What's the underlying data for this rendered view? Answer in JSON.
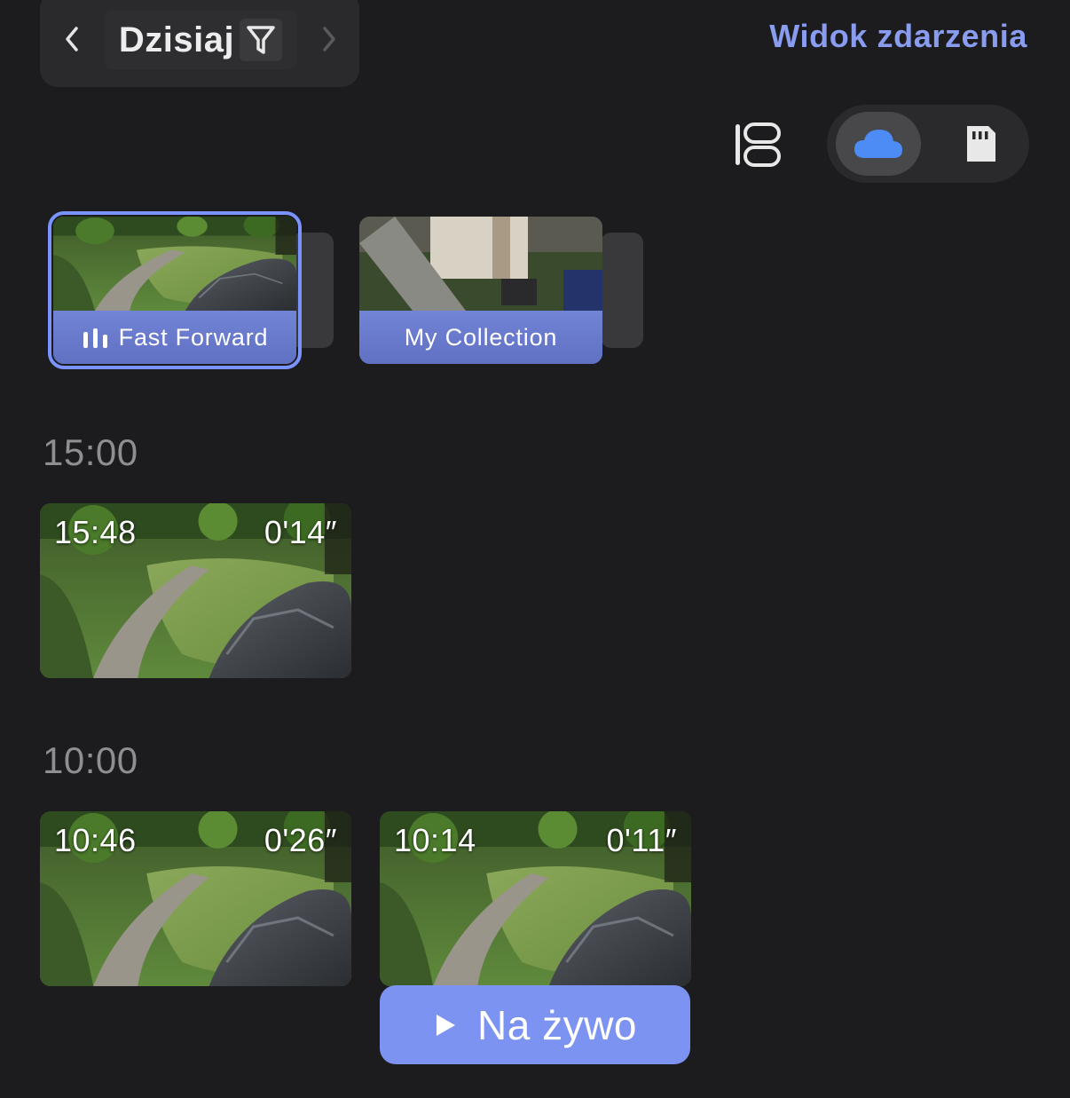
{
  "header": {
    "date_label": "Dzisiaj",
    "event_view_link": "Widok zdarzenia"
  },
  "storage": {
    "selected": "cloud",
    "options": [
      "cloud",
      "sd-card"
    ]
  },
  "albums": [
    {
      "label": "Fast Forward",
      "selected": true,
      "icon": "fast-forward-icon"
    },
    {
      "label": "My Collection",
      "selected": false
    }
  ],
  "groups": [
    {
      "hour": "15:00",
      "clips": [
        {
          "time": "15:48",
          "duration": "0'14″"
        }
      ]
    },
    {
      "hour": "10:00",
      "clips": [
        {
          "time": "10:46",
          "duration": "0'26″"
        },
        {
          "time": "10:14",
          "duration": "0'11″"
        }
      ]
    }
  ],
  "live_button": {
    "label": "Na żywo"
  },
  "colors": {
    "accent": "#8a9cf0",
    "background": "#1c1c1e",
    "live_button": "#7c93f2"
  }
}
